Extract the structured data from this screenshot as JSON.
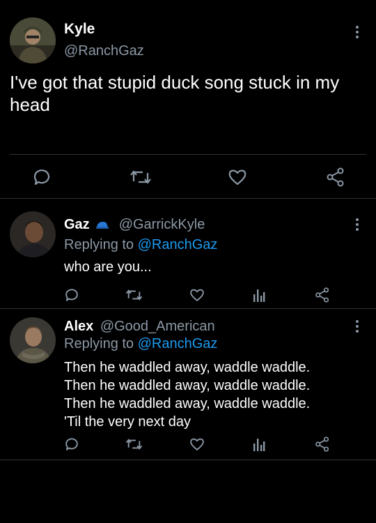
{
  "main_tweet": {
    "name": "Kyle",
    "handle": "@RanchGaz",
    "text_line1": "I've got that stupid duck song stuck in my",
    "text_line2": "head",
    "avatar_icon": "soldier-avatar-icon"
  },
  "replies": [
    {
      "name": "Gaz",
      "badge_icon": "blue-cap-icon",
      "handle": "@GarrickKyle",
      "replying_prefix": "Replying to",
      "replying_handle": "@RanchGaz",
      "text": "who are you..."
    },
    {
      "name": "Alex",
      "handle": "@Good_American",
      "replying_prefix": "Replying to",
      "replying_handle": "@RanchGaz",
      "lines": [
        "Then he waddled away, waddle waddle.",
        "Then he waddled away, waddle waddle.",
        "Then he waddled away, waddle waddle.",
        "'Til the very next day"
      ]
    }
  ],
  "colors": {
    "background": "#000000",
    "text": "#e7e9ea",
    "muted": "#8b98a5",
    "link": "#1d9bf0"
  }
}
